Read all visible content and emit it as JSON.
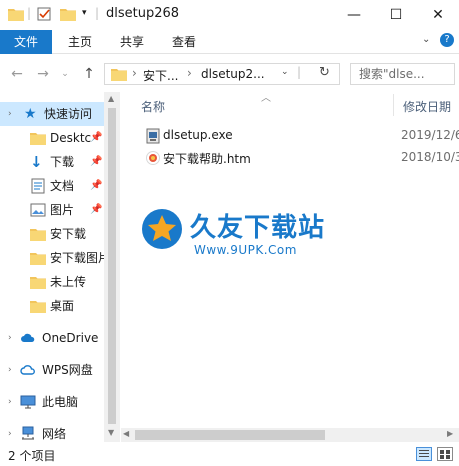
{
  "window": {
    "title": "dlsetup268",
    "minimize_glyph": "—",
    "maximize_glyph": "☐",
    "close_glyph": "✕"
  },
  "ribbon": {
    "tabs": [
      {
        "label": "文件"
      },
      {
        "label": "主页"
      },
      {
        "label": "共享"
      },
      {
        "label": "查看"
      }
    ]
  },
  "address": {
    "crumb1": "安下...",
    "separator": "›",
    "crumb2": "dlsetup2...",
    "search_placeholder": "搜索\"dlse..."
  },
  "sidebar": {
    "quick_access": "快速访问",
    "items": [
      {
        "label": "Desktc",
        "pinned": true
      },
      {
        "label": "下载",
        "pinned": true
      },
      {
        "label": "文档",
        "pinned": true
      },
      {
        "label": "图片",
        "pinned": true
      },
      {
        "label": "安下载",
        "pinned": false
      },
      {
        "label": "安下载图片",
        "pinned": false
      },
      {
        "label": "未上传",
        "pinned": false
      },
      {
        "label": "桌面",
        "pinned": false
      }
    ],
    "onedrive": "OneDrive",
    "wps": "WPS网盘",
    "thispc": "此电脑",
    "network": "网络"
  },
  "columns": {
    "name": "名称",
    "modified": "修改日期"
  },
  "files": [
    {
      "name": "dlsetup.exe",
      "date": "2019/12/6"
    },
    {
      "name": "安下载帮助.htm",
      "date": "2018/10/3"
    }
  ],
  "watermark": {
    "brand": "久友下载站",
    "url": "Www.9UPK.Com"
  },
  "status": {
    "count_text": "2 个项目"
  },
  "colors": {
    "accent": "#1979ca",
    "selected": "#cce8ff",
    "folder": "#f2c55c"
  }
}
